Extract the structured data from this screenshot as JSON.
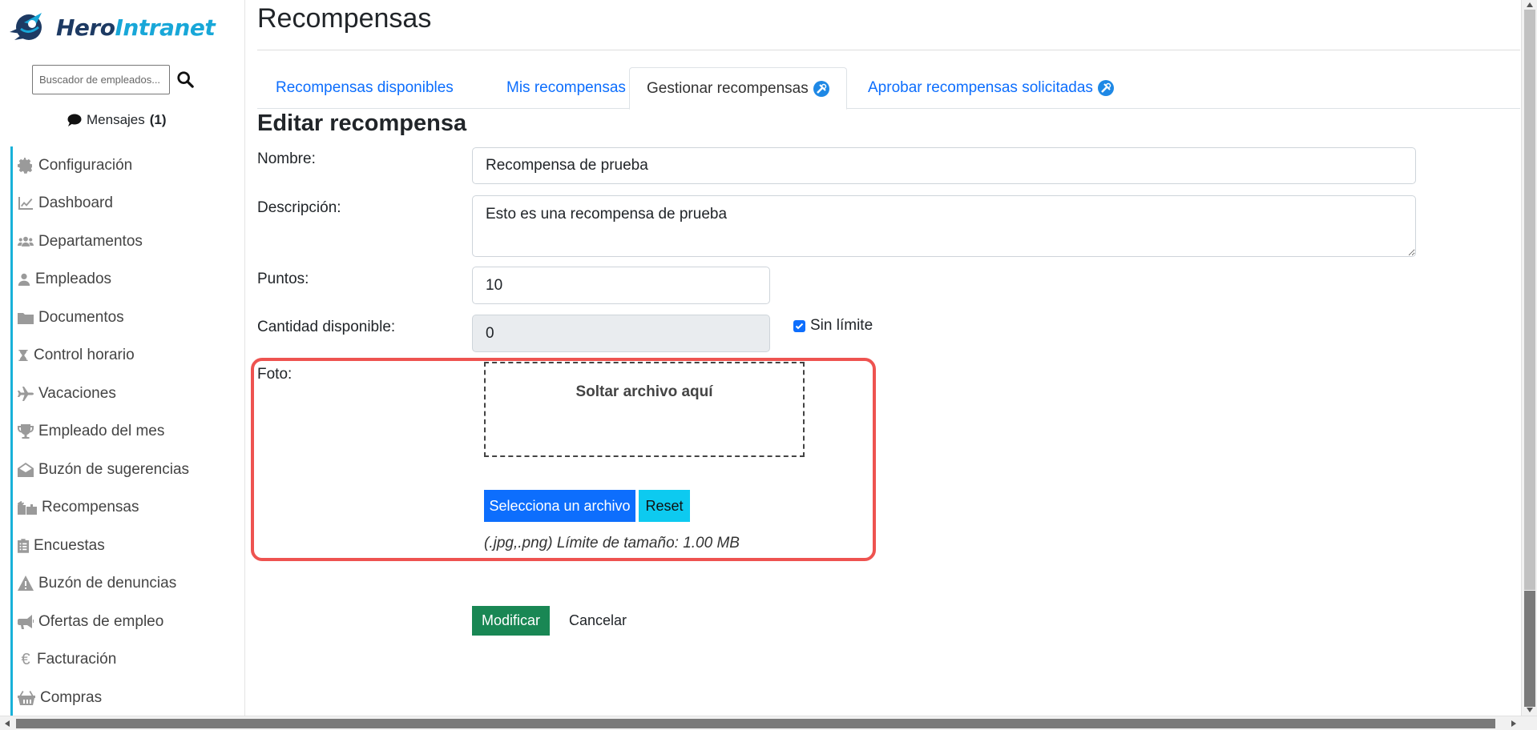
{
  "brand": {
    "hero": "Hero",
    "intranet": "Intranet"
  },
  "sidebar": {
    "search_placeholder": "Buscador de empleados...",
    "messages_label": "Mensajes",
    "messages_count": "(1)",
    "items": [
      {
        "label": "Configuración",
        "icon": "gear-icon"
      },
      {
        "label": "Dashboard",
        "icon": "chart-line-icon"
      },
      {
        "label": "Departamentos",
        "icon": "users-icon"
      },
      {
        "label": "Empleados",
        "icon": "user-icon"
      },
      {
        "label": "Documentos",
        "icon": "folder-icon"
      },
      {
        "label": "Control horario",
        "icon": "hourglass-icon"
      },
      {
        "label": "Vacaciones",
        "icon": "plane-icon"
      },
      {
        "label": "Empleado del mes",
        "icon": "trophy-icon"
      },
      {
        "label": "Buzón de sugerencias",
        "icon": "envelope-open-icon"
      },
      {
        "label": "Recompensas",
        "icon": "gifts-icon"
      },
      {
        "label": "Encuestas",
        "icon": "clipboard-list-icon"
      },
      {
        "label": "Buzón de denuncias",
        "icon": "warning-icon"
      },
      {
        "label": "Ofertas de empleo",
        "icon": "megaphone-icon"
      },
      {
        "label": "Facturación",
        "icon": "euro-icon"
      },
      {
        "label": "Compras",
        "icon": "basket-icon"
      }
    ]
  },
  "page": {
    "title": "Recompensas",
    "tabs": [
      {
        "label": "Recompensas disponibles"
      },
      {
        "label": "Mis recompensas"
      },
      {
        "label": "Gestionar recompensas"
      },
      {
        "label": "Aprobar recompensas solicitadas"
      }
    ],
    "section_title": "Editar recompensa"
  },
  "form": {
    "name_label": "Nombre:",
    "name_value": "Recompensa de prueba",
    "description_label": "Descripción:",
    "description_value": "Esto es una recompensa de prueba",
    "points_label": "Puntos:",
    "points_value": "10",
    "quantity_label": "Cantidad disponible:",
    "quantity_value": "0",
    "unlimited_label": "Sin límite",
    "unlimited_checked": true,
    "photo_label": "Foto:",
    "dropzone_text": "Soltar archivo aquí",
    "select_file_label": "Selecciona un archivo",
    "reset_label": "Reset",
    "file_hint": "(.jpg,.png) Límite de tamaño: 1.00 MB",
    "submit_label": "Modificar",
    "cancel_label": "Cancelar"
  },
  "colors": {
    "primary": "#0d6efd",
    "info": "#0dcaf0",
    "success": "#198754",
    "highlight": "#ee5350",
    "brand_dark": "#1d3a63",
    "brand_light": "#18a7d8"
  }
}
